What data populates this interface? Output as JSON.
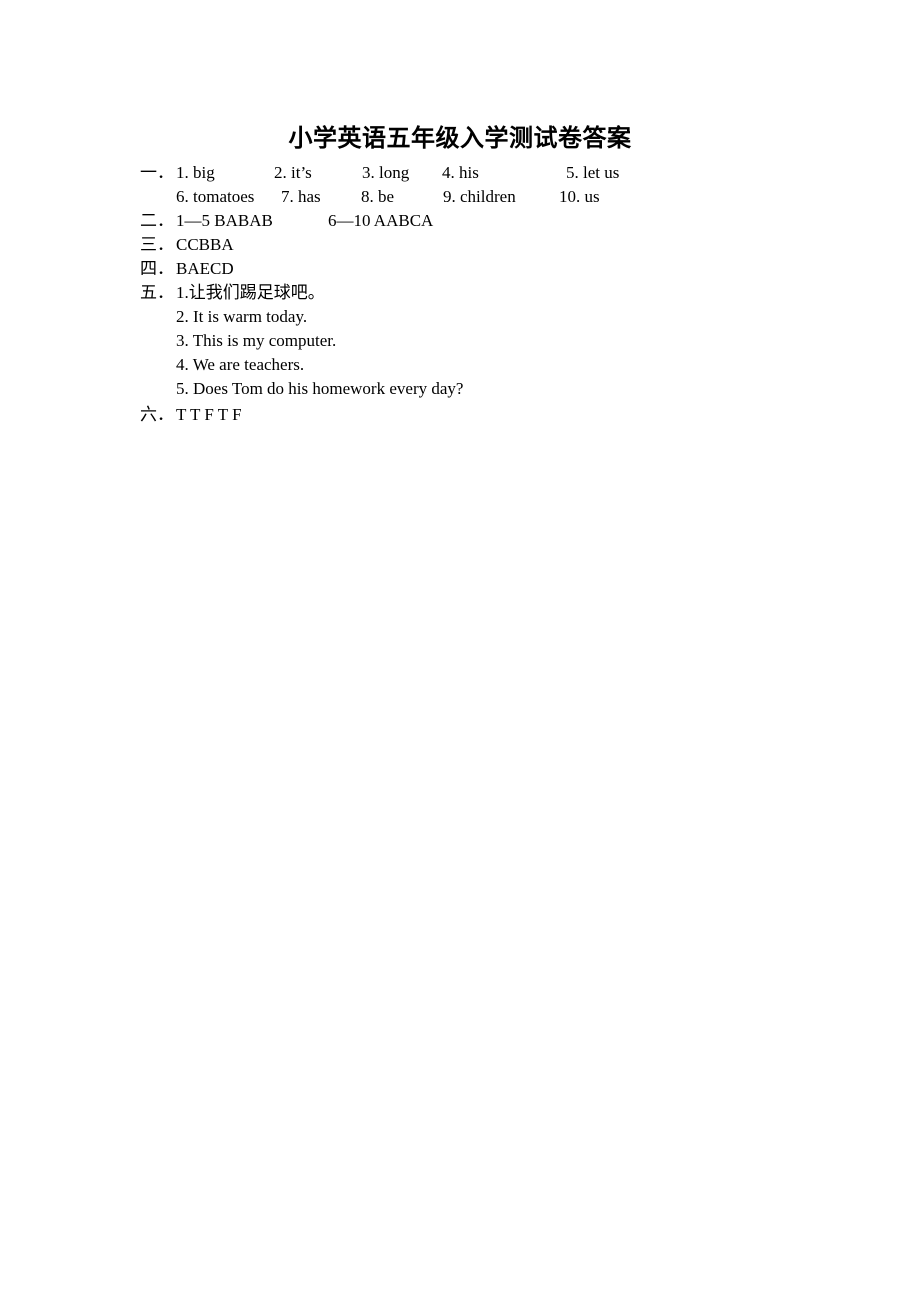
{
  "title": "小学英语五年级入学测试卷答案",
  "sections": {
    "s1": {
      "label": "一．",
      "row1": [
        "1. big",
        "2. it’s",
        "3. long",
        "4. his",
        "5. let us"
      ],
      "row2": [
        "6. tomatoes",
        "7. has",
        "8. be",
        "9. children",
        "10. us"
      ]
    },
    "s2": {
      "label": "二．",
      "parts": [
        "1—5 BABAB",
        "6—10 AABCA"
      ]
    },
    "s3": {
      "label": "三．",
      "answer": "CCBBA"
    },
    "s4": {
      "label": "四．",
      "answer": "BAECD"
    },
    "s5": {
      "label": "五．",
      "items": [
        "1.让我们踢足球吧。",
        "2. It is warm today.",
        "3. This is my computer.",
        "4. We are teachers.",
        "5. Does Tom do his homework every day?"
      ]
    },
    "s6": {
      "label": "六．",
      "answer": "T T F T F"
    }
  }
}
